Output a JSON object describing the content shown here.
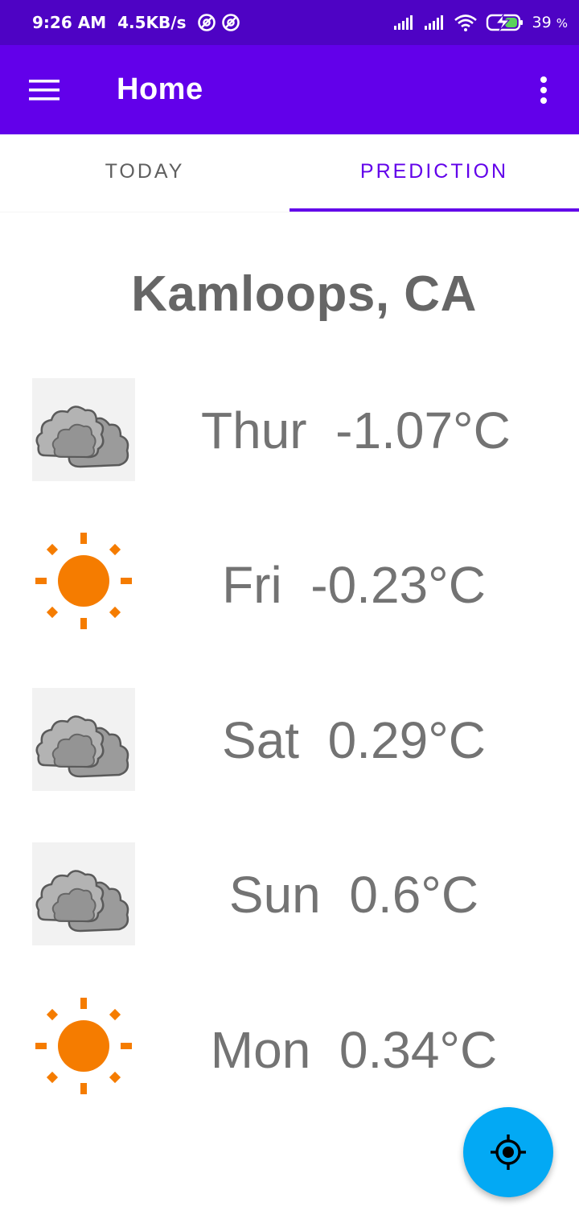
{
  "status_bar": {
    "time": "9:26 AM",
    "speed": "4.5KB/s",
    "battery": "39",
    "battery_unit": "%"
  },
  "app_bar": {
    "title": "Home",
    "menu_icon": "hamburger-menu-icon",
    "overflow_icon": "more-vert-icon"
  },
  "tabs": [
    {
      "label": "TODAY",
      "active": false
    },
    {
      "label": "PREDICTION",
      "active": true
    }
  ],
  "location": "Kamloops, CA",
  "forecast": [
    {
      "day": "Thur",
      "temp": "-1.07°C",
      "condition": "cloudy",
      "text": "Thur  -1.07°C"
    },
    {
      "day": "Fri",
      "temp": "-0.23°C",
      "condition": "sunny",
      "text": "Fri  -0.23°C"
    },
    {
      "day": "Sat",
      "temp": "0.29°C",
      "condition": "cloudy",
      "text": "Sat  0.29°C"
    },
    {
      "day": "Sun",
      "temp": "0.6°C",
      "condition": "cloudy",
      "text": "Sun  0.6°C"
    },
    {
      "day": "Mon",
      "temp": "0.34°C",
      "condition": "sunny",
      "text": "Mon  0.34°C"
    }
  ],
  "fab": {
    "icon": "my-location-icon"
  },
  "colors": {
    "status_bar": "#4e03c4",
    "primary": "#6200ea",
    "fab": "#03a9f4",
    "sun": "#f57c00",
    "text_gray": "#737373"
  }
}
